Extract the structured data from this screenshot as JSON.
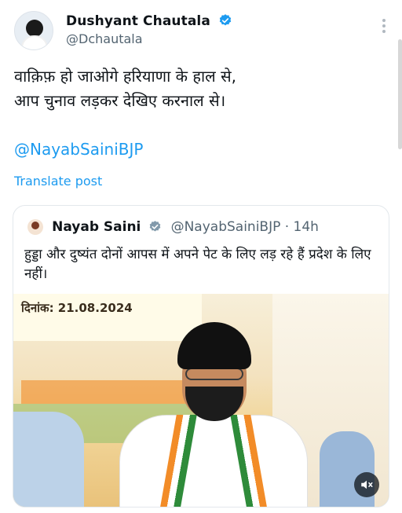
{
  "author": {
    "name": "Dushyant Chautala",
    "handle": "@Dchautala",
    "verified": true
  },
  "post": {
    "text_line_1": "वाक़िफ़ हो जाओगे हरियाणा के हाल से,",
    "text_line_2": "आप चुनाव लड़कर देखिए करनाल से।",
    "mention": "@NayabSainiBJP",
    "translate_label": "Translate post"
  },
  "quoted_post": {
    "name": "Nayab Saini",
    "handle_time": "@NayabSainiBJP · 14h",
    "text": "हुड्डा और दुष्यंत दोनों आपस में अपने पेट के लिए लड़ रहे हैं प्रदेश के लिए नहीं।",
    "media": {
      "date_caption": "दिनांक: 21.08.2024",
      "muted": true
    }
  },
  "colors": {
    "accent": "#1d9bf0",
    "text_primary": "#0f1419",
    "text_secondary": "#536471"
  },
  "icons": [
    "verified-badge-icon",
    "more-options-icon",
    "mute-icon"
  ]
}
